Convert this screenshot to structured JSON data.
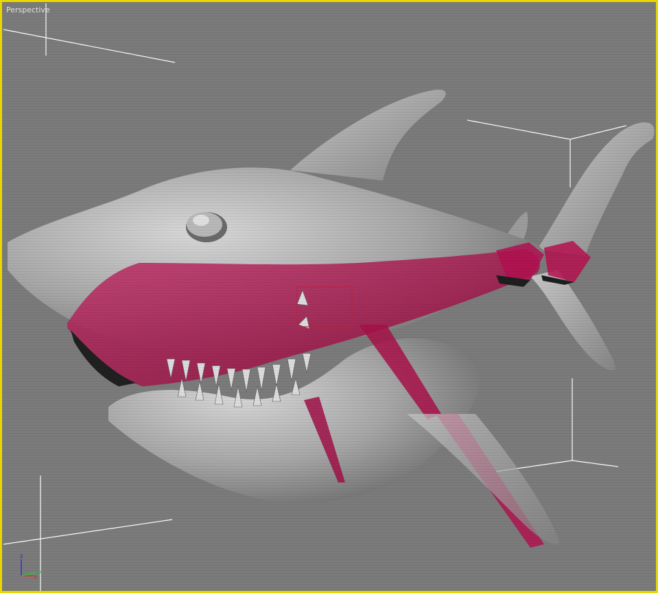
{
  "viewport": {
    "label": "Perspective",
    "border_color": "#e8d800",
    "background_color": "#7b7b7b",
    "active": true
  },
  "scene": {
    "object": "shark-model",
    "selection_color": "#b00040",
    "model_color": "#a8a8a8"
  },
  "axis_gizmo": {
    "z_label": "z",
    "x_label": "x",
    "y_label": "y",
    "colors": {
      "z": "#3030d0",
      "x": "#d03030",
      "y": "#30c030"
    }
  }
}
